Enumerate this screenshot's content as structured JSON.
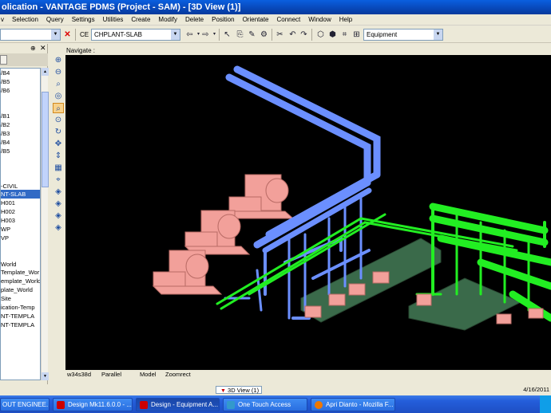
{
  "window": {
    "title": "olication - VANTAGE PDMS (Project - SAM) - [3D View (1)]"
  },
  "menu": [
    "Selection",
    "Query",
    "Settings",
    "Utilities",
    "Create",
    "Modify",
    "Delete",
    "Position",
    "Orientate",
    "Connect",
    "Window",
    "Help"
  ],
  "menu_first": "v",
  "toolbar": {
    "ce_label": "CE",
    "ce_value": "CHPLANT-SLAB",
    "mode_value": "Equipment"
  },
  "tree": {
    "items": [
      "/B4",
      "/B5",
      "/B6",
      "",
      "",
      "/B1",
      "/B2",
      "/B3",
      "/B4",
      "/B5",
      "",
      "",
      "",
      "-CIVIL",
      "NT-SLAB",
      "H001",
      "H002",
      "H003",
      "WP",
      "VP",
      "",
      "",
      "World",
      "Template_Wor",
      "emplate_World",
      "plate_World",
      "Site",
      "ication-Temp",
      "NT-TEMPLA",
      "NT-TEMPLA"
    ],
    "selected_index": 14
  },
  "view": {
    "navigate_label": "Navigate :",
    "status": {
      "name": "w34s38d",
      "projection": "Parallel",
      "mode": "Model",
      "action": "Zoomrect"
    },
    "tab_label": "3D View (1)",
    "date": "4/16/2011"
  },
  "taskbar": {
    "items": [
      {
        "label": "OUT ENGINEE...",
        "icon_color": "#d33"
      },
      {
        "label": "Design Mk11.6.0.0 - ...",
        "icon_color": "#c00"
      },
      {
        "label": "Design - Equipment A...",
        "icon_color": "#c00"
      },
      {
        "label": "One Touch Access",
        "icon_color": "#39c"
      },
      {
        "label": "Apri Dianto - Mozilla F...",
        "icon_color": "#e70"
      }
    ]
  },
  "colors": {
    "pipe_blue": "#6b8fff",
    "pipe_green": "#22ee22",
    "pump_pink": "#f2a09a",
    "slab_green": "#3a6a4a"
  }
}
